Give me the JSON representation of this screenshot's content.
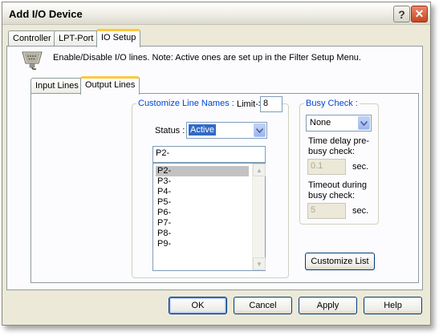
{
  "window": {
    "title": "Add I/O Device"
  },
  "titlebar": {
    "help_glyph": "?",
    "close_glyph": "✕"
  },
  "tabs": [
    {
      "label": "Controller"
    },
    {
      "label": "LPT-Port"
    },
    {
      "label": "IO Setup",
      "active": true
    }
  ],
  "info": {
    "icon": "parallel-port-connector-icon",
    "text": "Enable/Disable I/O lines. Note: Active ones are set up in the Filter Setup Menu."
  },
  "inner_tabs": [
    {
      "label": "Input Lines"
    },
    {
      "label": "Output Lines",
      "active": true
    }
  ],
  "customize": {
    "group_label": "Customize Line Names :",
    "limit_label": "Limit->",
    "limit_value": "8",
    "status_label": "Status :",
    "status_value": "Active",
    "name_value": "P2-",
    "lines": [
      "P2-",
      "P3-",
      "P4-",
      "P5-",
      "P6-",
      "P7-",
      "P8-",
      "P9-"
    ],
    "selected_index": 0
  },
  "busy": {
    "group_label": "Busy Check :",
    "mode_value": "None",
    "delay_label_1": "Time delay pre-",
    "delay_label_2": "busy check:",
    "delay_value": "0.1",
    "delay_unit": "sec.",
    "timeout_label_1": "Timeout during",
    "timeout_label_2": "busy check:",
    "timeout_value": "5",
    "timeout_unit": "sec.",
    "customize_button": "Customize List"
  },
  "buttons": {
    "ok": "OK",
    "cancel": "Cancel",
    "apply": "Apply",
    "help": "Help"
  },
  "colors": {
    "accent_blue": "#0046d5",
    "tab_highlight": "#ffc83c",
    "close_red": "#c64520"
  }
}
